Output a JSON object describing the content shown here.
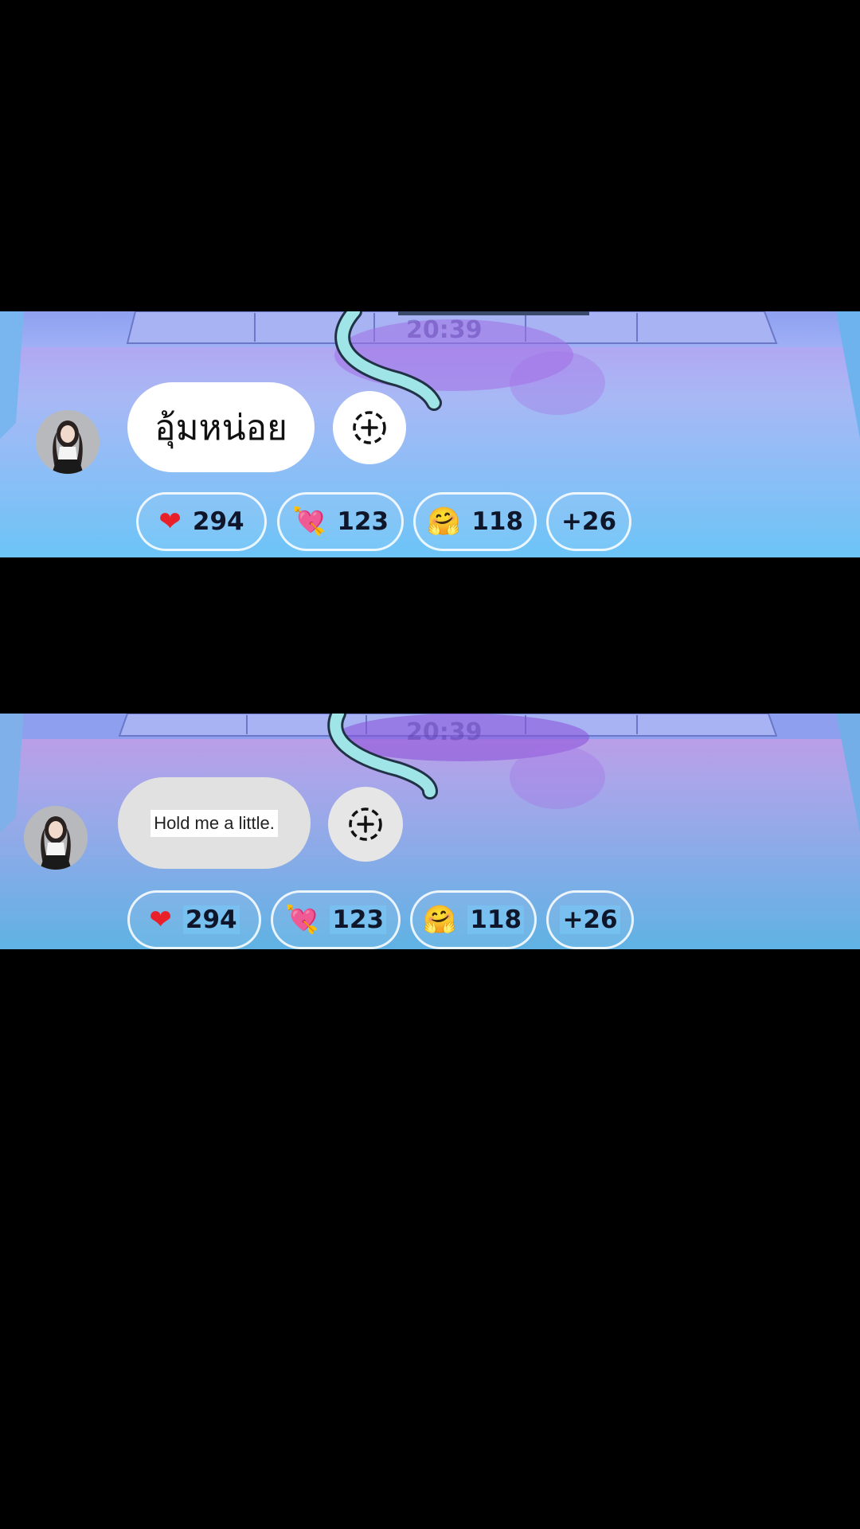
{
  "panels": [
    {
      "clock": "20:39",
      "message": "อุ้มหน่อย",
      "reactions": [
        {
          "icon": "red-heart-icon",
          "emoji": "❤",
          "color": "#e8202a",
          "count": "294"
        },
        {
          "icon": "heart-with-arrow-icon",
          "emoji": "💘",
          "color": "#f0508a",
          "count": "123"
        },
        {
          "icon": "hugging-face-icon",
          "emoji": "🤗",
          "color": "#f5b82e",
          "count": "118"
        },
        {
          "icon": "",
          "emoji": "",
          "count": "+26"
        }
      ]
    },
    {
      "clock": "20:39",
      "message": "Hold me a little.",
      "reactions": [
        {
          "icon": "red-heart-icon",
          "emoji": "❤",
          "color": "#e8202a",
          "count": "294"
        },
        {
          "icon": "heart-with-arrow-icon",
          "emoji": "💘",
          "color": "#f0508a",
          "count": "123"
        },
        {
          "icon": "hugging-face-icon",
          "emoji": "🤗",
          "color": "#f5b82e",
          "count": "118"
        },
        {
          "icon": "",
          "emoji": "",
          "count": "+26"
        }
      ]
    }
  ],
  "colors": {
    "scene_sky": "#7cc6f3",
    "scene_floor_purple": "#b08ae8",
    "bubble_white": "#ffffff",
    "bubble_gray": "#e1e1e1"
  }
}
